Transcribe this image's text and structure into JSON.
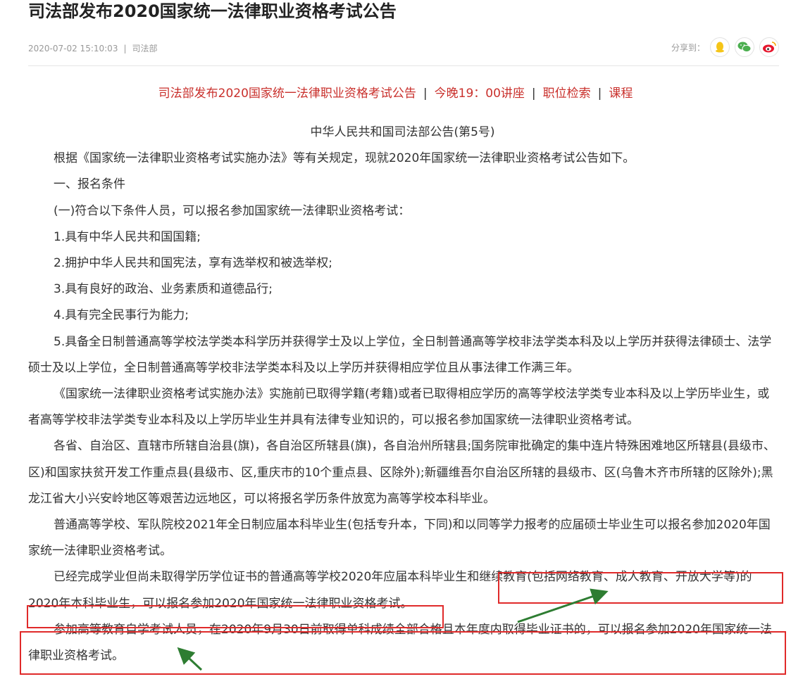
{
  "article": {
    "title": "司法部发布2020国家统一法律职业资格考试公告",
    "date": "2020-07-02 15:10:03",
    "separator": "|",
    "source": "司法部",
    "share_label": "分享到：",
    "share_icons": [
      "qq-icon",
      "wechat-icon",
      "weibo-icon"
    ]
  },
  "related_links": [
    {
      "label": "司法部发布2020国家统一法律职业资格考试公告"
    },
    {
      "label": "今晚19：00讲座"
    },
    {
      "label": "职位检索"
    },
    {
      "label": "课程"
    }
  ],
  "link_separator": "|",
  "body": {
    "heading": "中华人民共和国司法部公告(第5号)",
    "paragraphs": [
      "根据《国家统一法律职业资格考试实施办法》等有关规定，现就2020年国家统一法律职业资格考试公告如下。",
      "一、报名条件",
      "(一)符合以下条件人员，可以报名参加国家统一法律职业资格考试：",
      "1.具有中华人民共和国国籍;",
      "2.拥护中华人民共和国宪法，享有选举权和被选举权;",
      "3.具有良好的政治、业务素质和道德品行;",
      "4.具有完全民事行为能力;",
      "5.具备全日制普通高等学校法学类本科学历并获得学士及以上学位，全日制普通高等学校非法学类本科及以上学历并获得法律硕士、法学硕士及以上学位，全日制普通高等学校非法学类本科及以上学历并获得相应学位且从事法律工作满三年。",
      "《国家统一法律职业资格考试实施办法》实施前已取得学籍(考籍)或者已取得相应学历的高等学校法学类专业本科及以上学历毕业生，或者高等学校非法学类专业本科及以上学历毕业生并具有法律专业知识的，可以报名参加国家统一法律职业资格考试。",
      "各省、自治区、直辖市所辖自治县(旗)，各自治区所辖县(旗)，各自治州所辖县;国务院审批确定的集中连片特殊困难地区所辖县(县级市、区)和国家扶贫开发工作重点县(县级市、区,重庆市的10个重点县、区除外);新疆维吾尔自治区所辖的县级市、区(乌鲁木齐市所辖的区除外);黑龙江省大小兴安岭地区等艰苦边远地区，可以将报名学历条件放宽为高等学校本科毕业。",
      "普通高等学校、军队院校2021年全日制应届本科毕业生(包括专升本，下同)和以同等学力报考的应届硕士毕业生可以报名参加2020年国家统一法律职业资格考试。",
      "已经完成学业但尚未取得学历学位证书的普通高等学校2020年应届本科毕业生和继续教育(包括网络教育、成人教育、开放大学等)的2020年本科毕业生，可以报名参加2020年国家统一法律职业资格考试。",
      "参加高等教育自学考试人员，在2020年9月30日前取得单科成绩全部合格且本年度内取得毕业证书的，可以报名参加2020年国家统一法律职业资格考试。"
    ]
  },
  "annotations": {
    "box_color": "#e02a2a",
    "arrow_color": "#2e7d32"
  }
}
